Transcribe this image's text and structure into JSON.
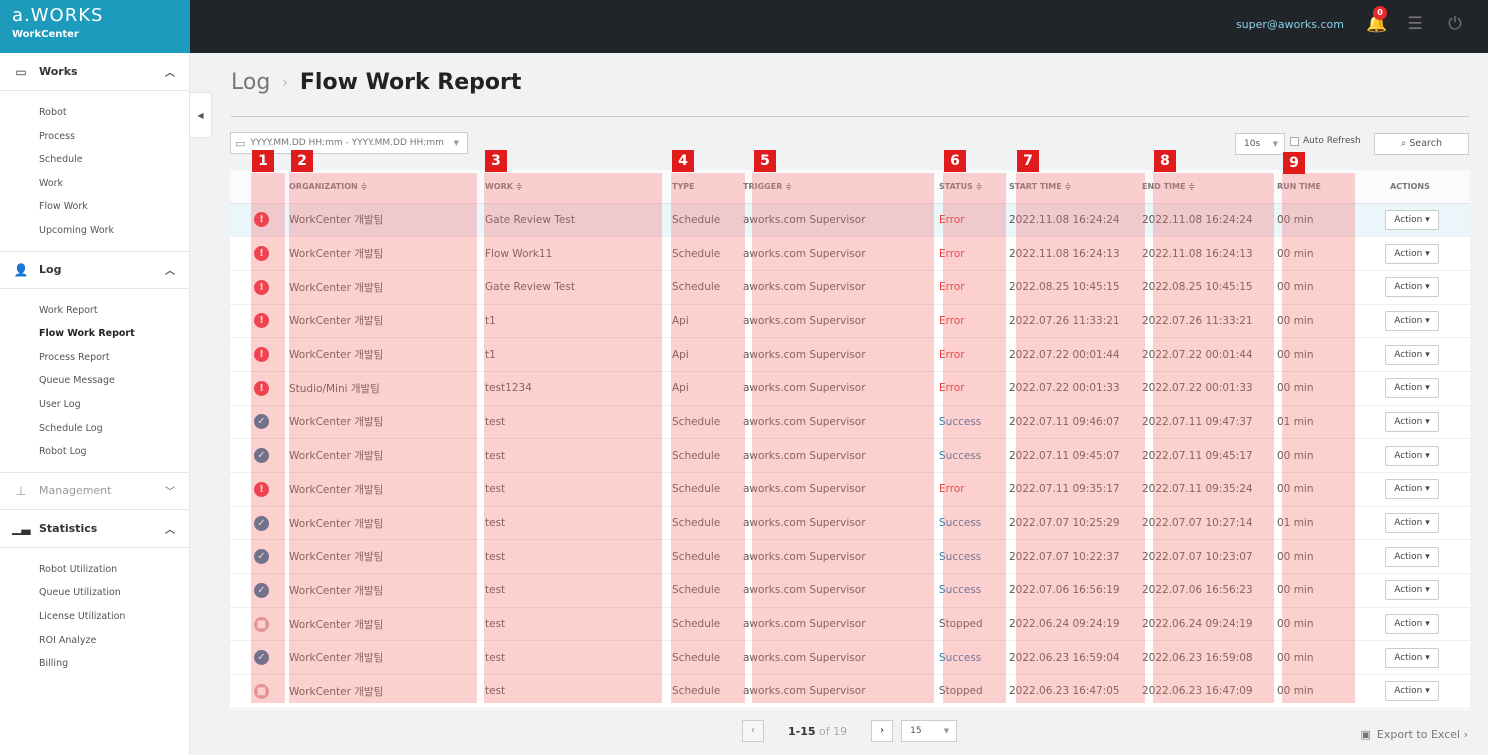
{
  "header": {
    "brand": "a.WORKS",
    "product": "WorkCenter",
    "user_email": "super@aworks.com",
    "notification_count": "0"
  },
  "sidebar": {
    "sections": [
      {
        "label": "Works",
        "icon": "calendar-icon",
        "expanded": true,
        "items": [
          "Robot",
          "Process",
          "Schedule",
          "Work",
          "Flow Work",
          "Upcoming Work"
        ]
      },
      {
        "label": "Log",
        "icon": "user-log-icon",
        "expanded": true,
        "items": [
          "Work Report",
          "Flow Work Report",
          "Process Report",
          "Queue Message",
          "User Log",
          "Schedule Log",
          "Robot Log"
        ],
        "active_item": "Flow Work Report"
      },
      {
        "label": "Management",
        "icon": "sitemap-icon",
        "expanded": false,
        "items": []
      },
      {
        "label": "Statistics",
        "icon": "bar-chart-icon",
        "expanded": true,
        "items": [
          "Robot Utilization",
          "Queue Utilization",
          "License Utilization",
          "ROI Analyze",
          "Billing"
        ]
      }
    ]
  },
  "breadcrumb": {
    "parent": "Log",
    "separator": "›",
    "current": "Flow Work Report"
  },
  "filters": {
    "date_range_placeholder": "YYYY.MM.DD HH:mm - YYYY.MM.DD HH:mm",
    "refresh_interval": "10s",
    "auto_refresh_label": "Auto Refresh",
    "search_label": "Search"
  },
  "table": {
    "columns": [
      "",
      "ORGANIZATION ≑",
      "WORK ≑",
      "TYPE",
      "TRIGGER ≑",
      "STATUS ≑",
      "START TIME ≑",
      "END TIME ≑",
      "RUN TIME",
      "ACTIONS"
    ],
    "action_label": "Action",
    "rows": [
      {
        "status": "error",
        "org": "WorkCenter 개발팀",
        "work": "Gate Review Test",
        "type": "Schedule",
        "trigger": "aworks.com Supervisor",
        "status_text": "Error",
        "start": "2022.11.08 16:24:24",
        "end": "2022.11.08 16:24:24",
        "run": "00 min"
      },
      {
        "status": "error",
        "org": "WorkCenter 개발팀",
        "work": "Flow Work11",
        "type": "Schedule",
        "trigger": "aworks.com Supervisor",
        "status_text": "Error",
        "start": "2022.11.08 16:24:13",
        "end": "2022.11.08 16:24:13",
        "run": "00 min"
      },
      {
        "status": "error",
        "org": "WorkCenter 개발팀",
        "work": "Gate Review Test",
        "type": "Schedule",
        "trigger": "aworks.com Supervisor",
        "status_text": "Error",
        "start": "2022.08.25 10:45:15",
        "end": "2022.08.25 10:45:15",
        "run": "00 min"
      },
      {
        "status": "error",
        "org": "WorkCenter 개발팀",
        "work": "t1",
        "type": "Api",
        "trigger": "aworks.com Supervisor",
        "status_text": "Error",
        "start": "2022.07.26 11:33:21",
        "end": "2022.07.26 11:33:21",
        "run": "00 min"
      },
      {
        "status": "error",
        "org": "WorkCenter 개발팀",
        "work": "t1",
        "type": "Api",
        "trigger": "aworks.com Supervisor",
        "status_text": "Error",
        "start": "2022.07.22 00:01:44",
        "end": "2022.07.22 00:01:44",
        "run": "00 min"
      },
      {
        "status": "error",
        "org": "Studio/Mini 개발팀",
        "work": "test1234",
        "type": "Api",
        "trigger": "aworks.com Supervisor",
        "status_text": "Error",
        "start": "2022.07.22 00:01:33",
        "end": "2022.07.22 00:01:33",
        "run": "00 min"
      },
      {
        "status": "success",
        "org": "WorkCenter 개발팀",
        "work": "test",
        "type": "Schedule",
        "trigger": "aworks.com Supervisor",
        "status_text": "Success",
        "start": "2022.07.11 09:46:07",
        "end": "2022.07.11 09:47:37",
        "run": "01 min"
      },
      {
        "status": "success",
        "org": "WorkCenter 개발팀",
        "work": "test",
        "type": "Schedule",
        "trigger": "aworks.com Supervisor",
        "status_text": "Success",
        "start": "2022.07.11 09:45:07",
        "end": "2022.07.11 09:45:17",
        "run": "00 min"
      },
      {
        "status": "error",
        "org": "WorkCenter 개발팀",
        "work": "test",
        "type": "Schedule",
        "trigger": "aworks.com Supervisor",
        "status_text": "Error",
        "start": "2022.07.11 09:35:17",
        "end": "2022.07.11 09:35:24",
        "run": "00 min"
      },
      {
        "status": "success",
        "org": "WorkCenter 개발팀",
        "work": "test",
        "type": "Schedule",
        "trigger": "aworks.com Supervisor",
        "status_text": "Success",
        "start": "2022.07.07 10:25:29",
        "end": "2022.07.07 10:27:14",
        "run": "01 min"
      },
      {
        "status": "success",
        "org": "WorkCenter 개발팀",
        "work": "test",
        "type": "Schedule",
        "trigger": "aworks.com Supervisor",
        "status_text": "Success",
        "start": "2022.07.07 10:22:37",
        "end": "2022.07.07 10:23:07",
        "run": "00 min"
      },
      {
        "status": "success",
        "org": "WorkCenter 개발팀",
        "work": "test",
        "type": "Schedule",
        "trigger": "aworks.com Supervisor",
        "status_text": "Success",
        "start": "2022.07.06 16:56:19",
        "end": "2022.07.06 16:56:23",
        "run": "00 min"
      },
      {
        "status": "stopped",
        "org": "WorkCenter 개발팀",
        "work": "test",
        "type": "Schedule",
        "trigger": "aworks.com Supervisor",
        "status_text": "Stopped",
        "start": "2022.06.24 09:24:19",
        "end": "2022.06.24 09:24:19",
        "run": "00 min"
      },
      {
        "status": "success",
        "org": "WorkCenter 개발팀",
        "work": "test",
        "type": "Schedule",
        "trigger": "aworks.com Supervisor",
        "status_text": "Success",
        "start": "2022.06.23 16:59:04",
        "end": "2022.06.23 16:59:08",
        "run": "00 min"
      },
      {
        "status": "stopped",
        "org": "WorkCenter 개발팀",
        "work": "test",
        "type": "Schedule",
        "trigger": "aworks.com Supervisor",
        "status_text": "Stopped",
        "start": "2022.06.23 16:47:05",
        "end": "2022.06.23 16:47:09",
        "run": "00 min"
      }
    ]
  },
  "column_markers": [
    "1",
    "2",
    "3",
    "4",
    "5",
    "6",
    "7",
    "8",
    "9"
  ],
  "pagination": {
    "range": "1-15",
    "of_label": "of 19",
    "page_size": "15"
  },
  "export_label": "Export to Excel ›",
  "colors": {
    "accent": "#1c9bbd",
    "error": "#e8293a",
    "success": "#2a6f96",
    "highlight": "#fa7878"
  }
}
